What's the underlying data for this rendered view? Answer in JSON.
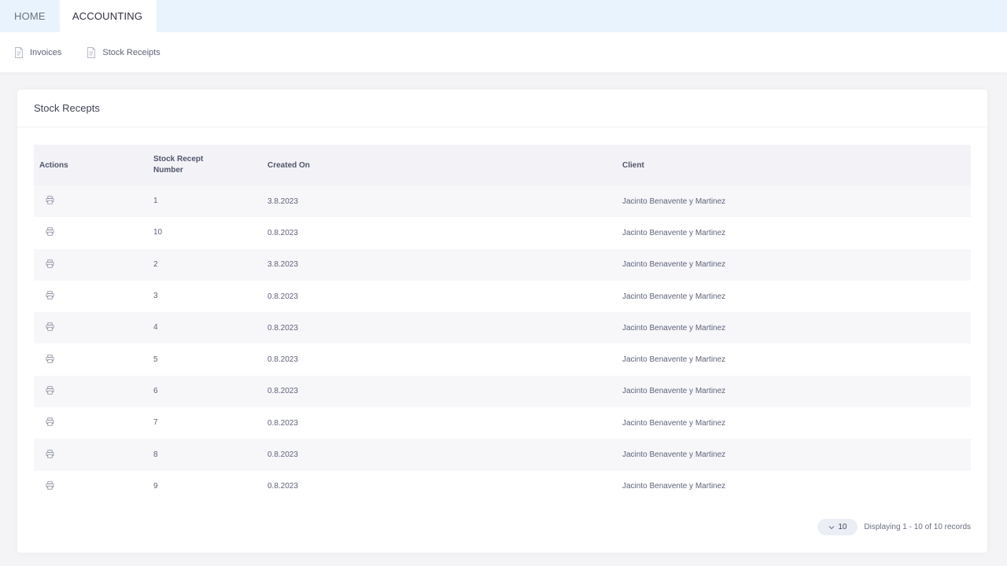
{
  "topnav": {
    "tabs": [
      {
        "label": "HOME"
      },
      {
        "label": "ACCOUNTING"
      }
    ],
    "active_tab": "ACCOUNTING"
  },
  "subnav": {
    "items": [
      {
        "label": "Invoices",
        "icon": "document-icon"
      },
      {
        "label": "Stock Receipts",
        "icon": "document-icon"
      }
    ]
  },
  "card": {
    "title": "Stock Recepts"
  },
  "table": {
    "headers": {
      "actions": "Actions",
      "number": "Stock Recept Number",
      "created": "Created On",
      "client": "Client"
    },
    "rows": [
      {
        "number": "1",
        "created": "3.8.2023",
        "client": "Jacinto Benavente y Martinez"
      },
      {
        "number": "10",
        "created": "0.8.2023",
        "client": "Jacinto Benavente y Martinez"
      },
      {
        "number": "2",
        "created": "3.8.2023",
        "client": "Jacinto Benavente y Martinez"
      },
      {
        "number": "3",
        "created": "0.8.2023",
        "client": "Jacinto Benavente y Martinez"
      },
      {
        "number": "4",
        "created": "0.8.2023",
        "client": "Jacinto Benavente y Martinez"
      },
      {
        "number": "5",
        "created": "0.8.2023",
        "client": "Jacinto Benavente y Martinez"
      },
      {
        "number": "6",
        "created": "0.8.2023",
        "client": "Jacinto Benavente y Martinez"
      },
      {
        "number": "7",
        "created": "0.8.2023",
        "client": "Jacinto Benavente y Martinez"
      },
      {
        "number": "8",
        "created": "0.8.2023",
        "client": "Jacinto Benavente y Martinez"
      },
      {
        "number": "9",
        "created": "0.8.2023",
        "client": "Jacinto Benavente y Martinez"
      }
    ]
  },
  "pagination": {
    "page_size": "10",
    "summary": "Displaying 1 - 10 of 10 records"
  },
  "colors": {
    "topbar": "#e9f3fd",
    "header_row": "#f3f3f7",
    "stripe": "#f7f7fa"
  }
}
